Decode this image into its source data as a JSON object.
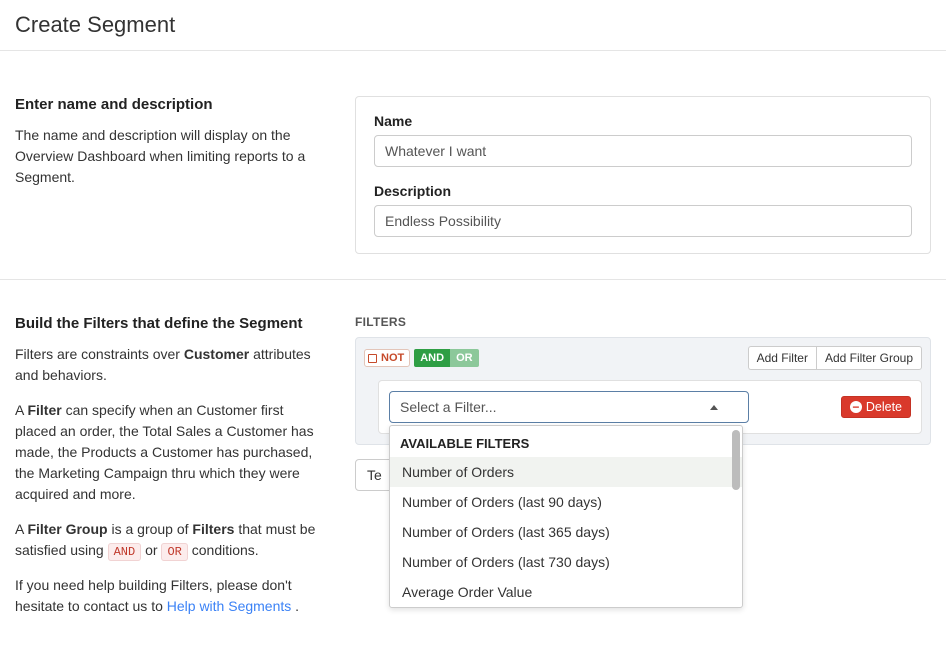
{
  "page": {
    "title": "Create Segment"
  },
  "section_name": {
    "heading": "Enter name and description",
    "help": "The name and description will display on the Overview Dashboard when limiting reports to a Segment.",
    "name_label": "Name",
    "name_value": "Whatever I want",
    "description_label": "Description",
    "description_value": "Endless Possibility"
  },
  "section_filters": {
    "heading": "Build the Filters that define the Segment",
    "help1_pre": "Filters are constraints over ",
    "help1_bold": "Customer",
    "help1_post": " attributes and behaviors.",
    "help2_pre": "A ",
    "help2_bold": "Filter",
    "help2_post": " can specify when an Customer first placed an order, the Total Sales a Customer has made, the Products a Customer has purchased, the Marketing Campaign thru which they were acquired and more.",
    "help3_pre": "A ",
    "help3_bold1": "Filter Group",
    "help3_mid1": " is a group of ",
    "help3_bold2": "Filters",
    "help3_mid2": " that must be satisfied using ",
    "help3_and": "AND",
    "help3_or_word": " or ",
    "help3_or": "OR",
    "help3_post": " conditions.",
    "help4_pre": "If you need help building Filters, please don't hesitate to contact us to ",
    "help4_link": "Help with Segments",
    "help4_post": " .",
    "filters_label": "FILTERS",
    "not_label": "NOT",
    "and_label": "AND",
    "or_label": "OR",
    "add_filter": "Add Filter",
    "add_filter_group": "Add Filter Group",
    "select_placeholder": "Select a Filter...",
    "delete_label": "Delete",
    "test_label": "Te",
    "dropdown": {
      "heading": "AVAILABLE FILTERS",
      "items": [
        "Number of Orders",
        "Number of Orders (last 90 days)",
        "Number of Orders (last 365 days)",
        "Number of Orders (last 730 days)",
        "Average Order Value"
      ]
    }
  }
}
